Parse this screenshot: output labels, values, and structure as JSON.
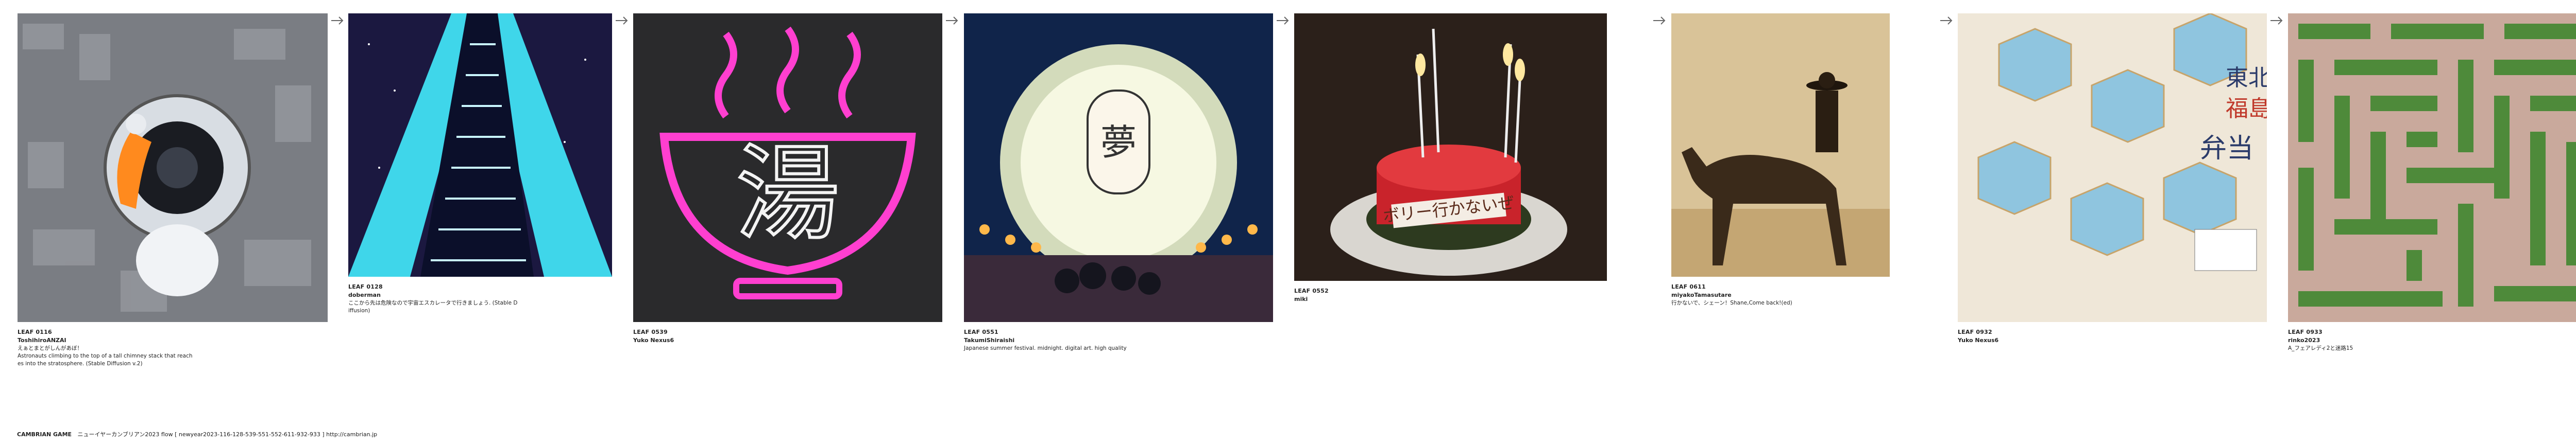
{
  "cards": [
    {
      "leaf": "LEAF 0116",
      "author": "ToshihiroANZAI",
      "caption": "えぁとまとがしんがあぼ！\nAstronauts climbing to the top of a tall chimney stack that reaches into the stratosphere. (Stable Diffusion v.2)",
      "thumb": "astronaut-chimney-image"
    },
    {
      "leaf": "LEAF 0128",
      "author": "doberman",
      "caption": "ここから先は危険なので宇宙エスカレータで行きましょう. (Stable Diffusion)",
      "thumb": "space-escalator-image"
    },
    {
      "leaf": "LEAF 0539",
      "author": "Yuko Nexus6",
      "caption": "",
      "thumb": "neon-yu-sign-image"
    },
    {
      "leaf": "LEAF 0551",
      "author": "TakumiShiraishi",
      "caption": "Japanese summer festival. midnight. digital art. high quality",
      "thumb": "summer-festival-image"
    },
    {
      "leaf": "LEAF 0552",
      "author": "miki",
      "caption": "",
      "thumb": "birthday-cake-image"
    },
    {
      "leaf": "LEAF 0611",
      "author": "miyakoTamasutare",
      "caption": "行かないで、シェーン！Shane,Come back!(ed)",
      "thumb": "cowboy-horse-image"
    },
    {
      "leaf": "LEAF 0932",
      "author": "Yuko Nexus6",
      "caption": "",
      "thumb": "tohoku-bento-image"
    },
    {
      "leaf": "LEAF 0933",
      "author": "rinko2023",
      "caption": "A_フェアレディ2と迷路15",
      "thumb": "maze-garden-image"
    }
  ],
  "footer": {
    "game": "CAMBRIAN GAME",
    "text": "ニューイヤーカンブリアン2023  flow [ newyear2023-116-128-539-551-552-611-932-933 ]    http://cambrian.jp"
  },
  "icons": {
    "arrow": "arrow-right-icon"
  },
  "colors": {
    "text": "#222222",
    "arrow": "#666666"
  }
}
